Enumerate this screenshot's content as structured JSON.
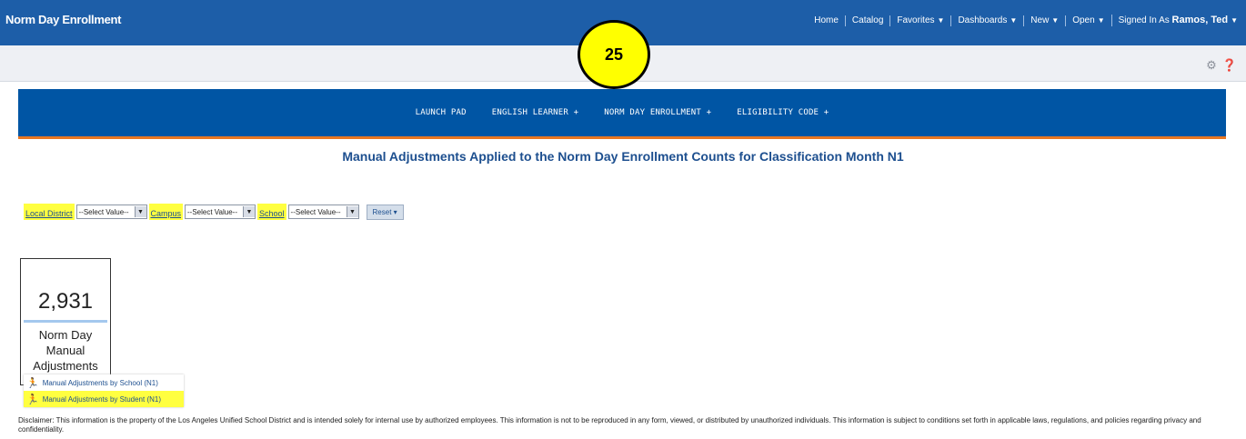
{
  "app_title": "Norm Day Enrollment",
  "topnav": {
    "home": "Home",
    "catalog": "Catalog",
    "favorites": "Favorites",
    "dashboards": "Dashboards",
    "new": "New",
    "open": "Open",
    "signed_in_label": "Signed In As",
    "user": "Ramos, Ted"
  },
  "badge": "25",
  "banner_nav": [
    "LAUNCH PAD",
    "ENGLISH LEARNER +",
    "NORM DAY ENROLLMENT +",
    "ELIGIBILITY CODE +"
  ],
  "page_title": "Manual Adjustments Applied to the Norm Day Enrollment Counts for Classification Month N1",
  "filters": {
    "local_district_label": "Local District",
    "campus_label": "Campus",
    "school_label": "School",
    "placeholder": "--Select Value--",
    "reset_label": "Reset"
  },
  "tile": {
    "value": "2,931",
    "label": "Norm Day Manual Adjustments"
  },
  "links": [
    "Manual Adjustments by School (N1)",
    "Manual Adjustments by Student (N1)"
  ],
  "disclaimer": "Disclaimer: This information is the property of the Los Angeles Unified School District and is intended solely for internal use by authorized employees. This information is not to be reproduced in any form, viewed, or distributed by unauthorized individuals. This information is subject to conditions set forth in applicable laws, regulations, and policies regarding privacy and confidentiality.",
  "colors": {
    "topbar": "#1d5ea8",
    "banner": "#0055a4",
    "accent": "#e87722",
    "highlight": "#ffff40"
  }
}
